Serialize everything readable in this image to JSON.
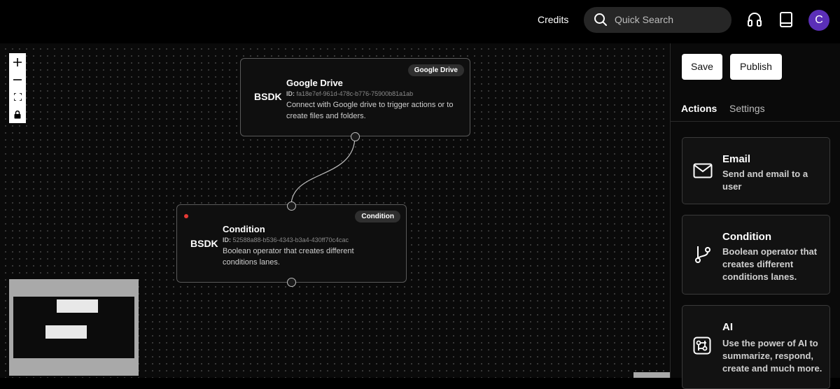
{
  "header": {
    "credits_label": "Credits",
    "search_placeholder": "Quick Search",
    "avatar_initial": "C"
  },
  "canvas": {
    "nodes": [
      {
        "badge": "Google Drive",
        "logo": "BSDK",
        "title": "Google Drive",
        "id_label": "ID:",
        "id_value": "fa18e7ef-961d-478c-b776-75900b81a1ab",
        "description": "Connect with Google drive to trigger actions or to create files and folders."
      },
      {
        "badge": "Condition",
        "logo": "BSDK",
        "title": "Condition",
        "id_label": "ID:",
        "id_value": "52588a88-b536-4343-b3a4-430ff70c4cac",
        "description": "Boolean operator that creates different conditions lanes."
      }
    ]
  },
  "panel": {
    "save_label": "Save",
    "publish_label": "Publish",
    "tabs": [
      {
        "label": "Actions",
        "active": true
      },
      {
        "label": "Settings",
        "active": false
      }
    ],
    "cards": [
      {
        "icon": "mail-icon",
        "title": "Email",
        "description": "Send and email to a user"
      },
      {
        "icon": "git-branch-icon",
        "title": "Condition",
        "description": "Boolean operator that creates different conditions lanes."
      },
      {
        "icon": "ai-icon",
        "title": "AI",
        "description": "Use the power of AI to summarize, respond, create and much more."
      }
    ]
  },
  "colors": {
    "background": "#000000",
    "canvas": "#0a0a0a",
    "avatar": "#5b2fb8",
    "error_dot": "#e53935"
  }
}
